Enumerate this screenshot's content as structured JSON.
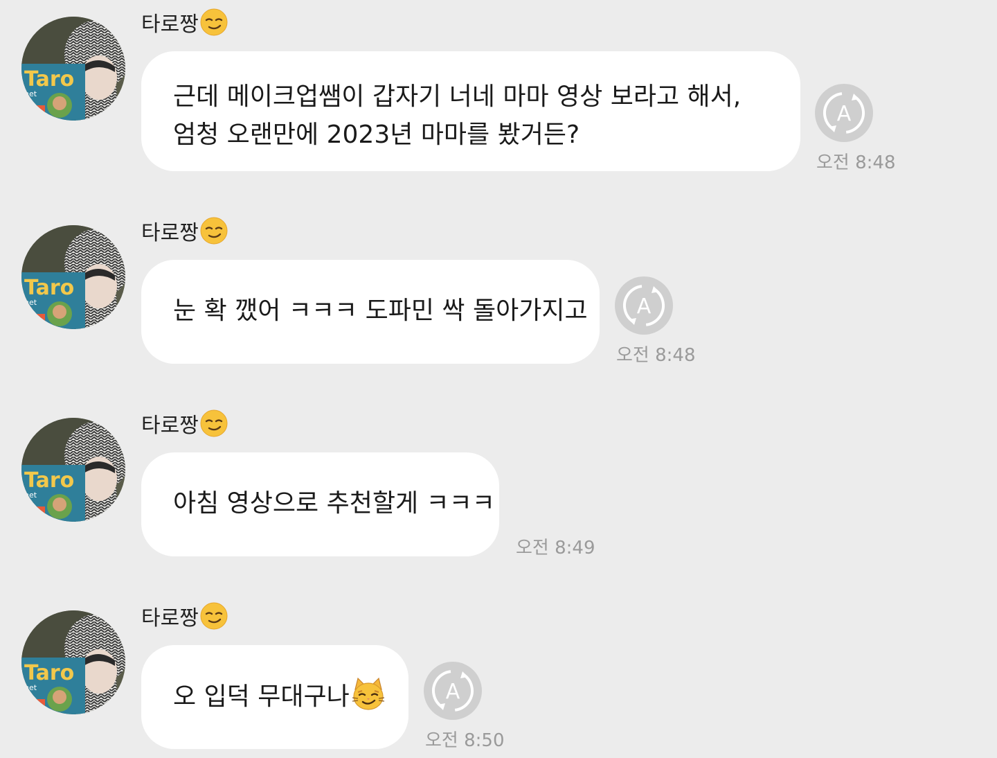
{
  "colors": {
    "background": "#ececec",
    "bubble": "#ffffff",
    "translate_icon_bg": "#cfcfcf",
    "timestamp": "#9a9a9a"
  },
  "messages": [
    {
      "sender": "타로짱",
      "sender_emoji": "smirking-face-icon",
      "lines": [
        "근데 메이크업쌤이 갑자기 너네 마마 영상 보라고 해서,",
        "엄청 오랜만에 2023년 마마를 봤거든?"
      ],
      "time": "오전 8:48",
      "has_translate_icon": true
    },
    {
      "sender": "타로짱",
      "sender_emoji": "smirking-face-icon",
      "lines": [
        "눈 확 깼어 ㅋㅋㅋ 도파민 싹 돌아가지고"
      ],
      "time": "오전 8:48",
      "has_translate_icon": true
    },
    {
      "sender": "타로짱",
      "sender_emoji": "smirking-face-icon",
      "lines": [
        "아침 영상으로 추천할게 ㅋㅋㅋ"
      ],
      "time": "오전 8:49",
      "has_translate_icon": false
    },
    {
      "sender": "타로짱",
      "sender_emoji": "smirking-face-icon",
      "lines": [
        "오 입덕 무대구나"
      ],
      "trailing_emoji": "smirking-cat-icon",
      "time": "오전 8:50",
      "has_translate_icon": true
    }
  ]
}
